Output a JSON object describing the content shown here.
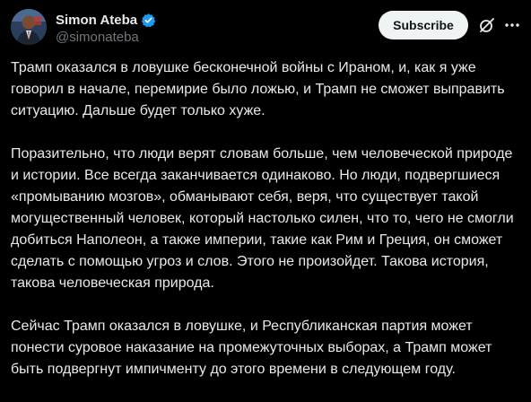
{
  "author": {
    "display_name": "Simon Ateba",
    "handle": "@simonateba",
    "verified": true,
    "verified_color": "#1d9bf0"
  },
  "actions": {
    "subscribe_label": "Subscribe",
    "grok_icon": "grok-icon",
    "more_icon": "more-icon"
  },
  "post": {
    "paragraphs": [
      "Трамп оказался в ловушке бесконечной войны с Ираном, и, как я уже говорил в начале, перемирие было ложью, и Трамп не сможет выправить ситуацию. Дальше будет только хуже.",
      "Поразительно, что люди верят словам больше, чем человеческой природе и истории. Все всегда заканчивается одинаково. Но люди, подвергшиеся «промыванию мозгов», обманывают себя, веря, что существует такой могущественный человек, который настолько силен, что то, чего не смогли добиться Наполеон, а также империи, такие как Рим и Греция, он сможет сделать с помощью угроз и слов. Этого не произойдет. Такова история, такова человеческая природа.",
      "Сейчас Трамп оказался в ловушке, и Республиканская партия может понести суровое наказание на промежуточных выборах, а Трамп может быть подвергнут импичменту до этого времени в следующем году."
    ]
  },
  "colors": {
    "background": "#000000",
    "text": "#e7e9ea",
    "secondary_text": "#71767b",
    "button_bg": "#eff3f4",
    "button_text": "#0f1419"
  }
}
